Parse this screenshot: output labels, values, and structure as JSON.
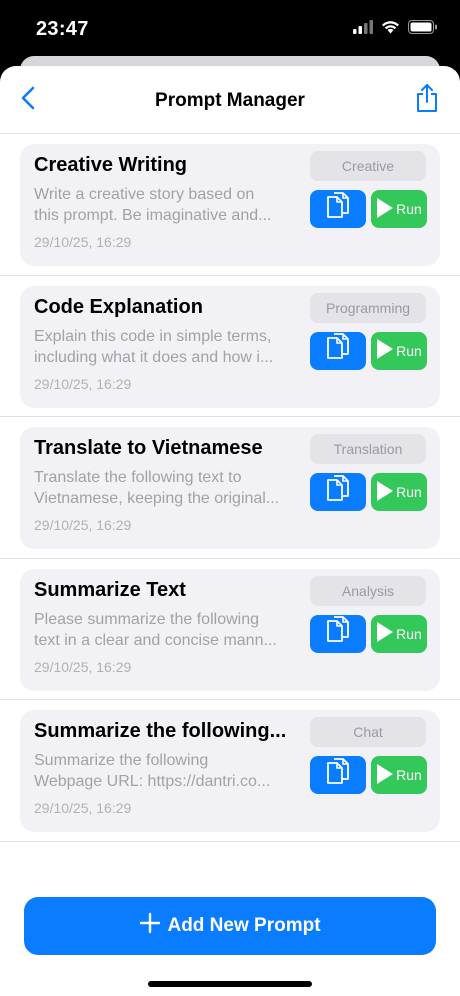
{
  "status_bar": {
    "time": "23:47"
  },
  "nav": {
    "title": "Prompt Manager",
    "back_icon": "chevron-left-icon",
    "share_icon": "share-icon"
  },
  "prompts": [
    {
      "title": "Creative Writing",
      "desc_line1": "Write a creative story based on",
      "desc_line2": "this prompt. Be imaginative and...",
      "date": "29/10/25, 16:29",
      "tag": "Creative",
      "run_label": "Run"
    },
    {
      "title": "Code Explanation",
      "desc_line1": "Explain this code in simple terms,",
      "desc_line2": "including what it does and how i...",
      "date": "29/10/25, 16:29",
      "tag": "Programming",
      "run_label": "Run"
    },
    {
      "title": "Translate to Vietnamese",
      "desc_line1": "Translate the following text to",
      "desc_line2": "Vietnamese, keeping the original...",
      "date": "29/10/25, 16:29",
      "tag": "Translation",
      "run_label": "Run"
    },
    {
      "title": "Summarize Text",
      "desc_line1": "Please summarize the following",
      "desc_line2": "text in a clear and concise mann...",
      "date": "29/10/25, 16:29",
      "tag": "Analysis",
      "run_label": "Run"
    },
    {
      "title": "Summarize the following...",
      "desc_line1": "Summarize the following",
      "desc_line2": "Webpage URL: https://dantri.co...",
      "date": "29/10/25, 16:29",
      "tag": "Chat",
      "run_label": "Run"
    }
  ],
  "add_button": {
    "label": "Add New Prompt"
  },
  "colors": {
    "accent": "#0a7cff",
    "run": "#34c759",
    "card_bg": "#f2f2f6"
  }
}
